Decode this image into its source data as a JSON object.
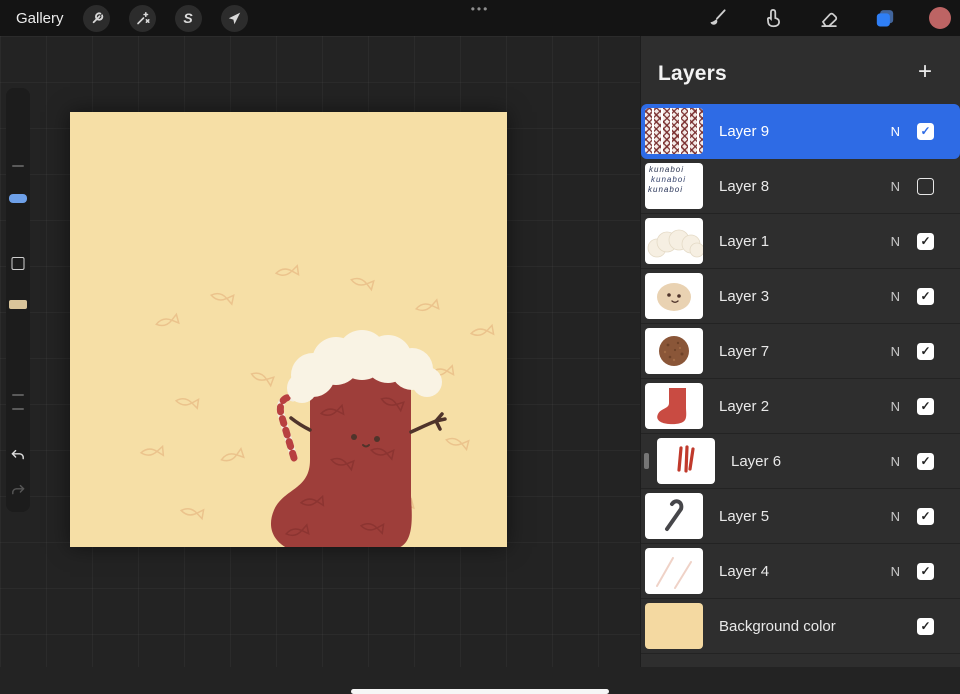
{
  "topbar": {
    "gallery_label": "Gallery",
    "menu_dots": "•••"
  },
  "icons": {
    "selection_s": "S",
    "checkmark": "✓"
  },
  "colors": {
    "accent_blue": "#2e6be5",
    "layers_tool_blue": "#2f7ff6",
    "current_color": "#bd6464",
    "canvas_cream": "#f6dfa6",
    "background_layer_cream": "#f4d9a1"
  },
  "layers_panel": {
    "title": "Layers",
    "add_button": "+",
    "rows": [
      {
        "name": "Layer 9",
        "blend": "N",
        "checked": true,
        "selected": true
      },
      {
        "name": "Layer 8",
        "blend": "N",
        "checked": false,
        "selected": false,
        "thumb_lines": [
          "kunaboi",
          "kunaboi",
          "kunaboi"
        ]
      },
      {
        "name": "Layer 1",
        "blend": "N",
        "checked": true,
        "selected": false
      },
      {
        "name": "Layer 3",
        "blend": "N",
        "checked": true,
        "selected": false
      },
      {
        "name": "Layer 7",
        "blend": "N",
        "checked": true,
        "selected": false
      },
      {
        "name": "Layer 2",
        "blend": "N",
        "checked": true,
        "selected": false
      },
      {
        "name": "Layer 6",
        "blend": "N",
        "checked": true,
        "selected": false
      },
      {
        "name": "Layer 5",
        "blend": "N",
        "checked": true,
        "selected": false
      },
      {
        "name": "Layer 4",
        "blend": "N",
        "checked": true,
        "selected": false
      },
      {
        "name": "Background color",
        "checked": true,
        "selected": false
      }
    ]
  }
}
